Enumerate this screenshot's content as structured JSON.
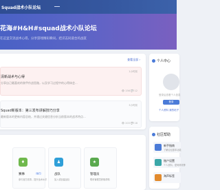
{
  "nav": {
    "brand": "Squad战术小队论坛"
  },
  "hero": {
    "title": "花海#H&H#squad战术小队论坛",
    "subtitle": "在这里交流战术心得，分享游戏精彩瞬间，结识志同道合的战友"
  },
  "posts": {
    "more": "查看全部 ›",
    "items": [
      {
        "title": "清新战术与心得",
        "desc": "分享自己最喜欢的装甲作战思路，以及学习过程中的心得体会...",
        "date": "1小时前",
        "stats": "👁 156   💬 12"
      },
      {
        "title": "Squad新版本：第三发布讲解技巧分享",
        "desc": "最新版本的更新内容总结，并通过关键信息分析当前版本的战术特点...",
        "date": "3小时前",
        "stats": "👁 203   💬 18"
      }
    ]
  },
  "profile": {
    "header": "个人中心",
    "note": "登录后查看个人信息",
    "login": "登录",
    "links": "个人资料    我的帖子"
  },
  "help": {
    "header": "社区帮助",
    "items": [
      {
        "title": "新手指南",
        "desc": "了解论坛基本功能",
        "color": "#4b7bd8"
      },
      {
        "title": "账户设置",
        "desc": "个人资料、密码修改等",
        "color": "#3aa7a8"
      },
      {
        "title": "海声标签",
        "desc": "",
        "color": "#e28b2e"
      }
    ]
  },
  "roles": [
    {
      "name": "赛事",
      "desc": "参与官方赛事，提升战术水平",
      "badge": "热门",
      "color": "#6fb84c",
      "icon": "♦"
    },
    {
      "name": "战队",
      "desc": "加入或创建战队",
      "badge": "",
      "color": "#2f9fd8",
      "icon": "♟"
    },
    {
      "name": "管理员",
      "desc": "联系管理员获取帮助",
      "badge": "",
      "color": "#5aa94e",
      "icon": "★"
    }
  ]
}
